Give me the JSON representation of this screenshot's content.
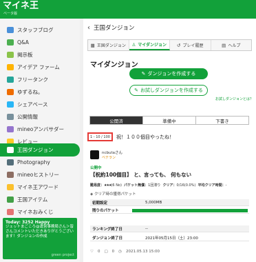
{
  "header": {
    "logo": "マイネ王",
    "logo_sub": "ベータ版"
  },
  "sidebar": {
    "items": [
      {
        "label": "スタッフブログ",
        "color": "#4a90d9"
      },
      {
        "label": "Q&A",
        "color": "#4caf50"
      },
      {
        "label": "掲示板",
        "color": "#8bc34a"
      },
      {
        "label": "アイデア ファーム",
        "color": "#ffb300"
      },
      {
        "label": "フリータンク",
        "color": "#26a69a"
      },
      {
        "label": "ゆずるね。",
        "color": "#ef6c00"
      },
      {
        "label": "シェアベース",
        "color": "#29b6f6"
      },
      {
        "label": "公開情報",
        "color": "#78909c"
      },
      {
        "label": "mineoアンバサダー",
        "color": "#9575cd"
      },
      {
        "label": "レビュー",
        "color": "#ffca28"
      },
      {
        "label": "王国ダンジョン",
        "color": "#12a13a"
      },
      {
        "label": "Photography",
        "color": "#546e7a"
      },
      {
        "label": "mineoヒストリー",
        "color": "#8d6e63"
      },
      {
        "label": "マイネ王アワード",
        "color": "#fbc02d"
      },
      {
        "label": "王国アイテム",
        "color": "#43a047"
      },
      {
        "label": "マイネおみくじ",
        "color": "#e57373"
      }
    ]
  },
  "today": {
    "title": "Today: 3252 Happy",
    "text": "ジェットまごころ@運営事務局さん＞皆さんコメントいただきありがとうございます！ダンジョンの作成",
    "brand": "green project"
  },
  "content": {
    "breadcrumb": "王国ダンジョン",
    "tabs": [
      {
        "label": "王国ダンジョン",
        "icon": "grid-icon"
      },
      {
        "label": "マイダンジョン",
        "icon": "user-icon"
      },
      {
        "label": "プレイ履歴",
        "icon": "history-icon"
      },
      {
        "label": "ヘルプ",
        "icon": "book-icon"
      }
    ],
    "heading": "マイダンジョン",
    "create_label": "ダンジョンを作成する",
    "trial_label": "お試しダンジョンを作成する",
    "what_link": "お試しダンジョンとは？",
    "status_tabs": [
      "公開済",
      "準備中",
      "下書き"
    ],
    "pager": "1 - 10 / 100",
    "post_title": "祝！１００個目やったね！",
    "user": {
      "name": "ncbutaさん",
      "rank": "ベテラン"
    },
    "status": "公開中",
    "dungeon_title": "【祝約100個目】 と、言っても、 何もない",
    "meta": {
      "difficulty_label": "難易度：",
      "stars": "★★★",
      "rating_count": "(6 No)",
      "packet_label": "パケット無償：",
      "packet_value": "1回滞り",
      "clear_label": "クリア：",
      "clear_value": "0/16(0.0%)",
      "avg_label": "平均クリア時間：",
      "avg_value": "-"
    },
    "packet_row": "クリア時の獲得パケット",
    "table": [
      {
        "key": "初期設定",
        "value": "5,000MB"
      },
      {
        "key": "残りのパケット",
        "value": ""
      },
      {
        "key": "ランキング終了日",
        "value": "--"
      },
      {
        "key": "ダンジョン終了日",
        "value": "2021年05月15日（土）23:00"
      }
    ],
    "remaining_fraction": 1.0,
    "footer": {
      "likes": "0",
      "comments": "0",
      "date": "2021.05.13 15:00"
    }
  }
}
